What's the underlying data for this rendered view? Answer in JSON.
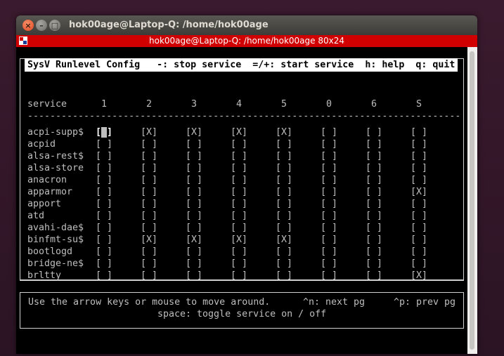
{
  "window": {
    "title": "hok00age@Laptop-Q: /home/hok00age",
    "tab_title": "hok00age@Laptop-Q: /home/hok00age 80x24",
    "close_glyph": "×",
    "min_glyph": "–",
    "max_glyph": "□"
  },
  "header": {
    "text": "SysV Runlevel Config   -: stop service  =/+: start service  h: help  q: quit"
  },
  "columns": {
    "service": "service",
    "levels": [
      "1",
      "2",
      "3",
      "4",
      "5",
      "0",
      "6",
      "S"
    ]
  },
  "separator": "-----------------------------------------------------------------------------",
  "rows": [
    {
      "name": "acpi-supp$",
      "cells": [
        "[ ]",
        "[X]",
        "[X]",
        "[X]",
        "[X]",
        "[ ]",
        "[ ]",
        "[ ]"
      ]
    },
    {
      "name": "acpid",
      "cells": [
        "[ ]",
        "[ ]",
        "[ ]",
        "[ ]",
        "[ ]",
        "[ ]",
        "[ ]",
        "[ ]"
      ]
    },
    {
      "name": "alsa-rest$",
      "cells": [
        "[ ]",
        "[ ]",
        "[ ]",
        "[ ]",
        "[ ]",
        "[ ]",
        "[ ]",
        "[ ]"
      ]
    },
    {
      "name": "alsa-store",
      "cells": [
        "[ ]",
        "[ ]",
        "[ ]",
        "[ ]",
        "[ ]",
        "[ ]",
        "[ ]",
        "[ ]"
      ]
    },
    {
      "name": "anacron",
      "cells": [
        "[ ]",
        "[ ]",
        "[ ]",
        "[ ]",
        "[ ]",
        "[ ]",
        "[ ]",
        "[ ]"
      ]
    },
    {
      "name": "apparmor",
      "cells": [
        "[ ]",
        "[ ]",
        "[ ]",
        "[ ]",
        "[ ]",
        "[ ]",
        "[ ]",
        "[X]"
      ]
    },
    {
      "name": "apport",
      "cells": [
        "[ ]",
        "[ ]",
        "[ ]",
        "[ ]",
        "[ ]",
        "[ ]",
        "[ ]",
        "[ ]"
      ]
    },
    {
      "name": "atd",
      "cells": [
        "[ ]",
        "[ ]",
        "[ ]",
        "[ ]",
        "[ ]",
        "[ ]",
        "[ ]",
        "[ ]"
      ]
    },
    {
      "name": "avahi-dae$",
      "cells": [
        "[ ]",
        "[ ]",
        "[ ]",
        "[ ]",
        "[ ]",
        "[ ]",
        "[ ]",
        "[ ]"
      ]
    },
    {
      "name": "binfmt-su$",
      "cells": [
        "[ ]",
        "[X]",
        "[X]",
        "[X]",
        "[X]",
        "[ ]",
        "[ ]",
        "[ ]"
      ]
    },
    {
      "name": "bootlogd",
      "cells": [
        "[ ]",
        "[ ]",
        "[ ]",
        "[ ]",
        "[ ]",
        "[ ]",
        "[ ]",
        "[ ]"
      ]
    },
    {
      "name": "bridge-ne$",
      "cells": [
        "[ ]",
        "[ ]",
        "[ ]",
        "[ ]",
        "[ ]",
        "[ ]",
        "[ ]",
        "[ ]"
      ]
    },
    {
      "name": "brltty",
      "cells": [
        "[ ]",
        "[ ]",
        "[ ]",
        "[ ]",
        "[ ]",
        "[ ]",
        "[ ]",
        "[X]"
      ]
    }
  ],
  "help": {
    "line1_left": "Use the arrow keys or mouse to move around.",
    "line1_next": "^n: next pg",
    "line1_prev": "^p: prev pg",
    "line2": "space: toggle service on / off"
  },
  "colors": {
    "tab_bar": "#d10000",
    "terminal_bg": "#000000",
    "terminal_fg": "#bebebe"
  }
}
